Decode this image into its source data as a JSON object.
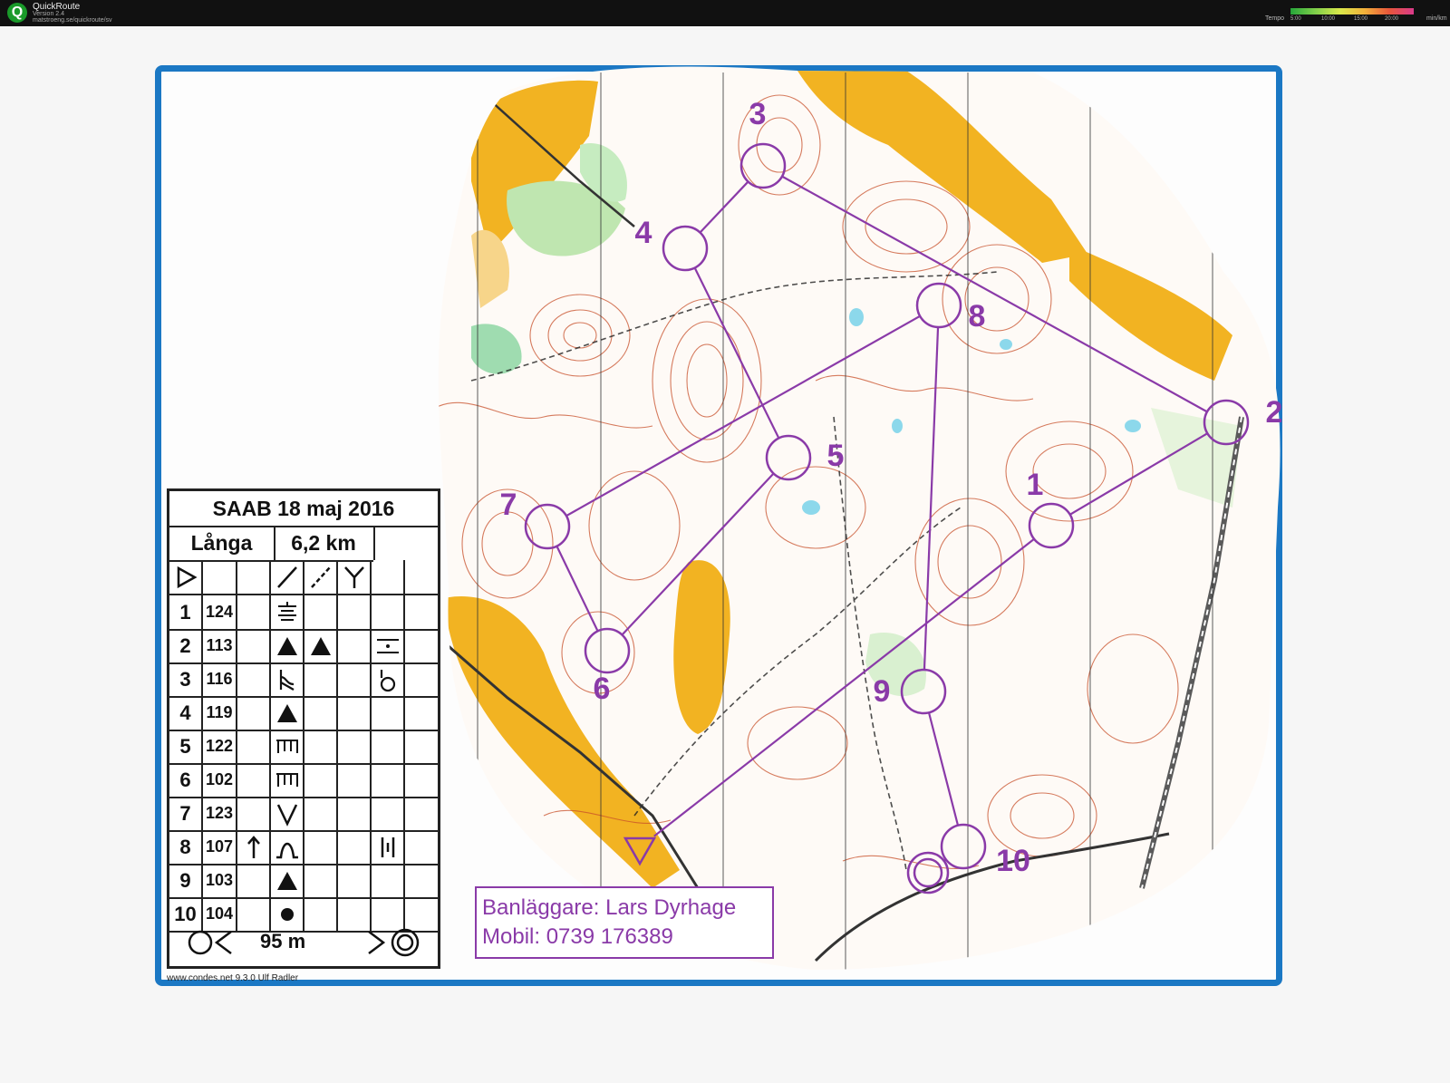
{
  "app": {
    "title": "QuickRoute",
    "version": "Version 2.4",
    "url": "matstroeng.se/quickroute/sv",
    "logo_letter": "Q"
  },
  "legend": {
    "label": "Tempo",
    "ticks": [
      "5:00",
      "10:00",
      "15:00",
      "20:00"
    ],
    "unit": "min/km"
  },
  "event": {
    "title": "SAAB 18 maj 2016",
    "course": "Långa",
    "length": "6,2 km"
  },
  "controls": [
    {
      "num": "1",
      "code": "124"
    },
    {
      "num": "2",
      "code": "113"
    },
    {
      "num": "3",
      "code": "116"
    },
    {
      "num": "4",
      "code": "119"
    },
    {
      "num": "5",
      "code": "122"
    },
    {
      "num": "6",
      "code": "102"
    },
    {
      "num": "7",
      "code": "123"
    },
    {
      "num": "8",
      "code": "107"
    },
    {
      "num": "9",
      "code": "103"
    },
    {
      "num": "10",
      "code": "104"
    }
  ],
  "finish": {
    "distance": "95 m"
  },
  "credit": "www.condes.net 9.3.0 Ulf Radler",
  "course_setter": {
    "name": "Banläggare: Lars Dyrhage",
    "phone": "Mobil: 0739 176389"
  },
  "colors": {
    "frame": "#1b78c4",
    "course": "#8a3aa8",
    "open_land": "#f2b322",
    "contour": "#c8502a",
    "vegetation": "#7fd09a"
  }
}
